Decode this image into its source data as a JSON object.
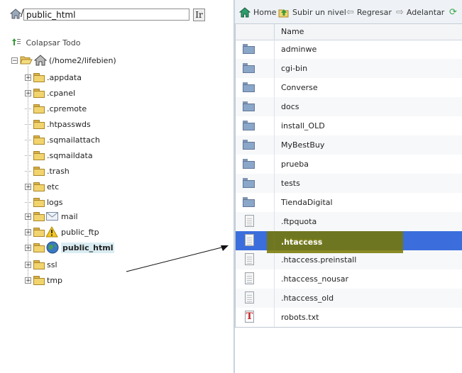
{
  "path_bar": {
    "value": "public_html",
    "go_label": "Ir"
  },
  "tree": {
    "collapse_label": "Colapsar Todo",
    "root_label": "(/home2/lifebien)",
    "items": [
      {
        "label": ".appdata",
        "expandable": true
      },
      {
        "label": ".cpanel",
        "expandable": true
      },
      {
        "label": ".cpremote",
        "expandable": false
      },
      {
        "label": ".htpasswds",
        "expandable": false
      },
      {
        "label": ".sqmailattach",
        "expandable": false
      },
      {
        "label": ".sqmaildata",
        "expandable": false
      },
      {
        "label": ".trash",
        "expandable": false
      },
      {
        "label": "etc",
        "expandable": true
      },
      {
        "label": "logs",
        "expandable": false
      },
      {
        "label": "mail",
        "expandable": true,
        "icon": "mail-icon"
      },
      {
        "label": "public_ftp",
        "expandable": true,
        "icon": "ftp-warning-icon"
      },
      {
        "label": "public_html",
        "expandable": true,
        "icon": "globe-icon",
        "selected": true
      },
      {
        "label": "ssl",
        "expandable": true
      },
      {
        "label": "tmp",
        "expandable": true
      }
    ]
  },
  "toolbar": {
    "home": "Home",
    "up": "Subir un nivel",
    "back": "Regresar",
    "forward": "Adelantar"
  },
  "file_list": {
    "header": "Name",
    "rows": [
      {
        "name": "adminwe",
        "type": "folder"
      },
      {
        "name": "cgi-bin",
        "type": "folder"
      },
      {
        "name": "Converse",
        "type": "folder"
      },
      {
        "name": "docs",
        "type": "folder"
      },
      {
        "name": "install_OLD",
        "type": "folder"
      },
      {
        "name": "MyBestBuy",
        "type": "folder"
      },
      {
        "name": "prueba",
        "type": "folder"
      },
      {
        "name": "tests",
        "type": "folder"
      },
      {
        "name": "TiendaDigital",
        "type": "folder"
      },
      {
        "name": ".ftpquota",
        "type": "file"
      },
      {
        "name": ".htaccess",
        "type": "file",
        "selected": true
      },
      {
        "name": ".htaccess.preinstall",
        "type": "file"
      },
      {
        "name": ".htaccess_nousar",
        "type": "file"
      },
      {
        "name": ".htaccess_old",
        "type": "file"
      },
      {
        "name": "robots.txt",
        "type": "text"
      }
    ]
  },
  "colors": {
    "selection": "#3b6edc",
    "highlight": "#6b7000",
    "folder": "#f2d46e"
  }
}
